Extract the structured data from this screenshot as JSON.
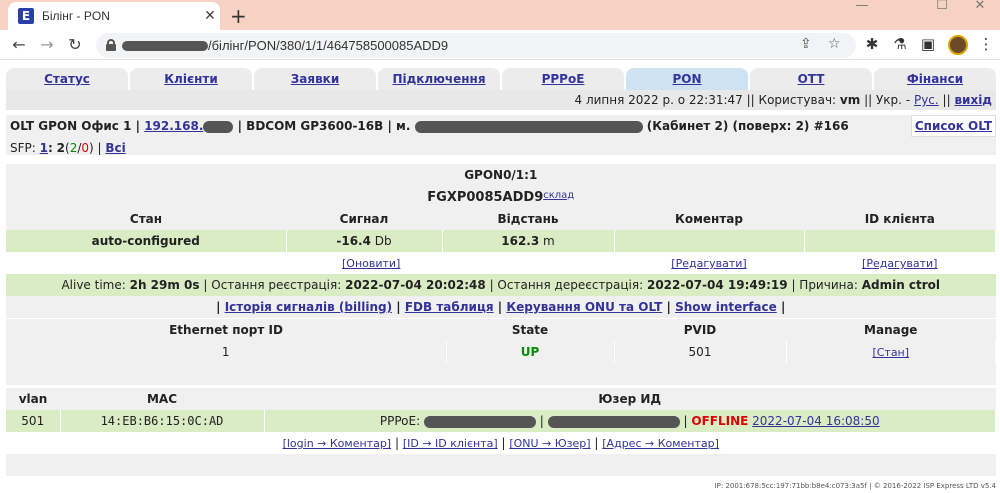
{
  "browser": {
    "tab_title": "Білінг - PON",
    "favicon_letter": "E",
    "url_visible": "/білінг/PON/380/1/1/464758500085ADD9",
    "new_tab": "+",
    "close": "✕",
    "min": "—",
    "max": "☐",
    "winclose": "✕",
    "back": "←",
    "forward": "→",
    "reload": "↻",
    "share": "⇪",
    "star": "☆",
    "puzzle": "✱",
    "flask": "⚗",
    "sidepanel": "▣",
    "menu": "⋮"
  },
  "nav": {
    "tabs": [
      "Статус",
      "Клієнти",
      "Заявки",
      "Підключення",
      "PPPoE",
      "PON",
      "OTT",
      "Фінанси"
    ],
    "active": "PON"
  },
  "userbar": {
    "datetime": "4 липня 2022 р. о 22:31:47",
    "sep1": "||",
    "user_label": "Користувач:",
    "user": "vm",
    "sep2": "||",
    "lang_label": "Укр. -",
    "lang_link": "Рус.",
    "sep3": "||",
    "logout": "вихід"
  },
  "olt": {
    "title_prefix": "OLT GPON Офис 1 |",
    "ip": "192.168.",
    "model": "| BDCOM GP3600-16B | м.",
    "location_tail": "(Кабинет 2) (поверх: 2) #166",
    "list_link": "Список OLT",
    "sfp_label": "SFP:",
    "sfp_1": "1",
    "sfp_2": "2",
    "sfp_2_green": "2",
    "sfp_2_red": "0",
    "sfp_all": "Всі"
  },
  "gpon": {
    "port": "GPON0/1:1",
    "serial": "FGXP0085ADD9",
    "sklad": "склад",
    "headers": [
      "Стан",
      "Сигнал",
      "Відстань",
      "Коментар",
      "ID клієнта"
    ],
    "state": "auto-configured",
    "signal_value": "-16.4",
    "signal_unit": "Db",
    "distance_value": "162.3",
    "distance_unit": "m",
    "comment": "",
    "client_id": "",
    "refresh": "[Оновити]",
    "edit_comment": "[Редагувати]",
    "edit_client": "[Редагувати]",
    "alive_label": "Alive time:",
    "alive": "2h 29m 0s",
    "last_reg_label": "| Остання реєстрація:",
    "last_reg": "2022-07-04 20:02:48",
    "last_dereg_label": "| Остання дереєстрація:",
    "last_dereg": "2022-07-04 19:49:19",
    "reason_label": "| Причина:",
    "reason": "Admin ctrol",
    "links": [
      "Історія сигналів (billing)",
      "FDB таблиця",
      "Керування ONU та OLT",
      "Show interface"
    ],
    "link_sep": "|"
  },
  "ports": {
    "headers": [
      "Ethernet порт ID",
      "State",
      "PVID",
      "Manage"
    ],
    "rows": [
      {
        "id": "1",
        "state": "UP",
        "pvid": "501",
        "manage": "[Стан]"
      }
    ]
  },
  "vlan": {
    "headers": [
      "vlan",
      "MAC",
      "Юзер ИД"
    ],
    "rows": [
      {
        "vlan": "501",
        "mac": "14:EB:B6:15:0C:AD",
        "pppoe_label": "PPPoE:",
        "sep": "|",
        "status": "OFFLINE",
        "time": "2022-07-04 16:08:50"
      }
    ],
    "actions": [
      "[login → Коментар]",
      "[ID → ID клієнта]",
      "[ONU → Юзер]",
      "[Адрес → Коментар]"
    ],
    "action_sep": "|"
  },
  "footer": "IP: 2001:678:5cc:197:71bb:b8e4:c073:3a5f | © 2016-2022 ISP Express LTD v5.4"
}
